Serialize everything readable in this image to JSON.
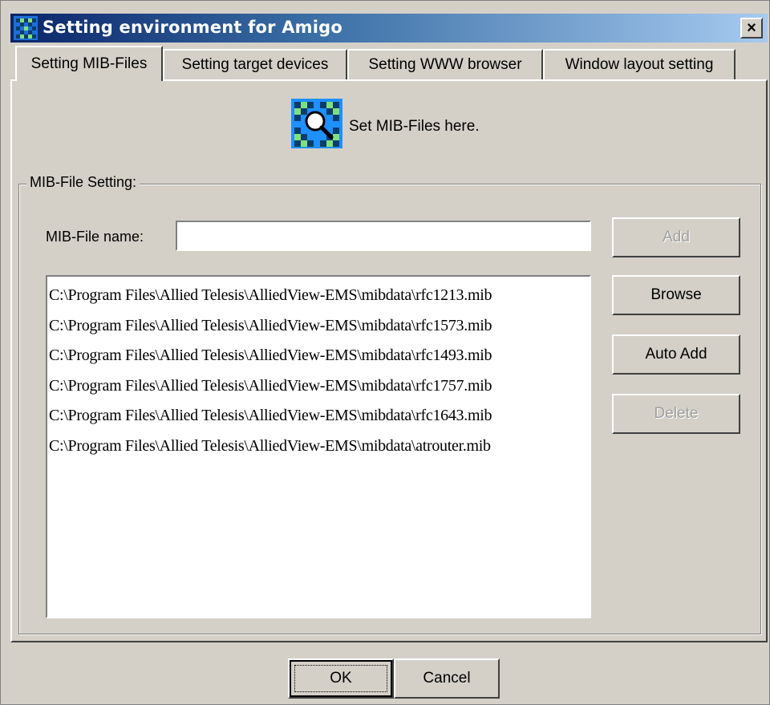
{
  "window": {
    "title": "Setting environment for Amigo",
    "close_label": "×"
  },
  "tabs": [
    {
      "label": "Setting MIB-Files",
      "active": true
    },
    {
      "label": "Setting target devices",
      "active": false
    },
    {
      "label": "Setting WWW browser",
      "active": false
    },
    {
      "label": "Window layout setting",
      "active": false
    }
  ],
  "header": {
    "icon": "mib-search-icon",
    "text": "Set MIB-Files here."
  },
  "group": {
    "label": "MIB-File Setting:",
    "field_label": "MIB-File name:",
    "field_value": ""
  },
  "mib_files": [
    "C:\\Program Files\\Allied Telesis\\AlliedView-EMS\\mibdata\\rfc1213.mib",
    "C:\\Program Files\\Allied Telesis\\AlliedView-EMS\\mibdata\\rfc1573.mib",
    "C:\\Program Files\\Allied Telesis\\AlliedView-EMS\\mibdata\\rfc1493.mib",
    "C:\\Program Files\\Allied Telesis\\AlliedView-EMS\\mibdata\\rfc1757.mib",
    "C:\\Program Files\\Allied Telesis\\AlliedView-EMS\\mibdata\\rfc1643.mib",
    "C:\\Program Files\\Allied Telesis\\AlliedView-EMS\\mibdata\\atrouter.mib"
  ],
  "buttons": {
    "add": "Add",
    "browse": "Browse",
    "auto_add": "Auto Add",
    "delete": "Delete",
    "ok": "OK",
    "cancel": "Cancel"
  },
  "colors": {
    "titlebar_start": "#0a246a",
    "titlebar_end": "#a6caf0",
    "face": "#d4d0c8",
    "icon_blue": "#1e90ff"
  }
}
